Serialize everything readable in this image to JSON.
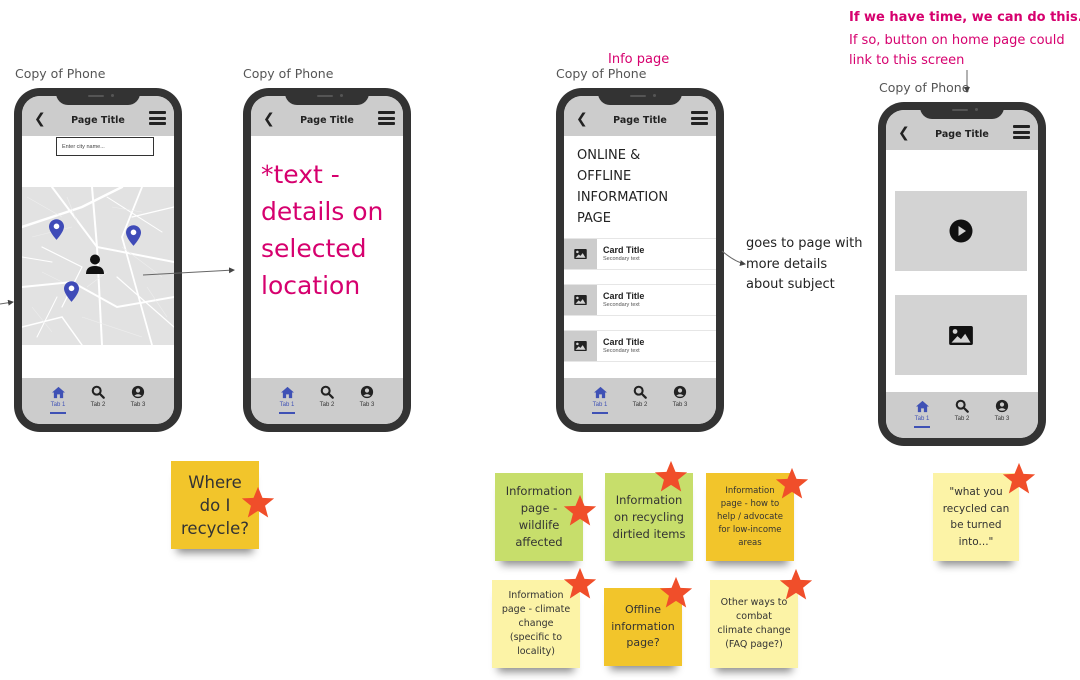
{
  "colors": {
    "accent_pink": "#d6006e",
    "phone_frame": "#333333",
    "header_gray": "#cccccc",
    "tab_active": "#3f51b5",
    "pin_blue": "#3f4bb8",
    "star_red": "#f04e2a",
    "sticky_yellow": "#f5d033",
    "sticky_green": "#c7de6b",
    "sticky_pale": "#fcf3a6"
  },
  "phones": [
    {
      "frame_label": "Copy of Phone",
      "header": {
        "back_icon": "chevron-left-icon",
        "title": "Page Title",
        "menu_icon": "hamburger-menu-icon"
      },
      "search": {
        "placeholder": "Enter city name..."
      },
      "map": {
        "pins": [
          "location-pin-icon",
          "location-pin-icon",
          "location-pin-icon"
        ],
        "user_icon": "user-icon"
      },
      "tabs": [
        {
          "label": "Tab 1",
          "icon": "home-icon",
          "active": true
        },
        {
          "label": "Tab 2",
          "icon": "search-icon",
          "active": false
        },
        {
          "label": "Tab 3",
          "icon": "account-circle-icon",
          "active": false
        }
      ]
    },
    {
      "frame_label": "Copy of Phone",
      "header": {
        "back_icon": "chevron-left-icon",
        "title": "Page Title",
        "menu_icon": "hamburger-menu-icon"
      },
      "body_text": [
        "*text -",
        "details on",
        "selected",
        "location"
      ],
      "tabs": [
        {
          "label": "Tab 1",
          "icon": "home-icon",
          "active": true
        },
        {
          "label": "Tab 2",
          "icon": "search-icon",
          "active": false
        },
        {
          "label": "Tab 3",
          "icon": "account-circle-icon",
          "active": false
        }
      ]
    },
    {
      "frame_label": "Copy of Phone",
      "annotation_above": "Info page",
      "header": {
        "back_icon": "chevron-left-icon",
        "title": "Page Title",
        "menu_icon": "hamburger-menu-icon"
      },
      "heading_lines": [
        "ONLINE &",
        "OFFLINE",
        "INFORMATION",
        "PAGE"
      ],
      "cards": [
        {
          "title": "Card Title",
          "secondary": "Secondary text",
          "icon": "image-icon"
        },
        {
          "title": "Card Title",
          "secondary": "Secondary text",
          "icon": "image-icon"
        },
        {
          "title": "Card Title",
          "secondary": "Secondary text",
          "icon": "image-icon"
        }
      ],
      "tabs": [
        {
          "label": "Tab 1",
          "icon": "home-icon",
          "active": true
        },
        {
          "label": "Tab 2",
          "icon": "search-icon",
          "active": false
        },
        {
          "label": "Tab 3",
          "icon": "account-circle-icon",
          "active": false
        }
      ]
    },
    {
      "frame_label": "Copy of Phone",
      "header": {
        "back_icon": "chevron-left-icon",
        "title": "Page Title",
        "menu_icon": "hamburger-menu-icon"
      },
      "media": [
        "play-circle-icon",
        "image-icon"
      ],
      "tabs": [
        {
          "label": "Tab 1",
          "icon": "home-icon",
          "active": true
        },
        {
          "label": "Tab 2",
          "icon": "search-icon",
          "active": false
        },
        {
          "label": "Tab 3",
          "icon": "account-circle-icon",
          "active": false
        }
      ]
    }
  ],
  "annotations": {
    "cards_note": [
      "goes to page with",
      "more details",
      "about subject"
    ],
    "stretch_bold": "If we have time, we can do this.",
    "stretch_lines": [
      "If so, button on home page could",
      "link to this screen"
    ]
  },
  "stickies": [
    {
      "lines": [
        "Where",
        "do I",
        "recycle?"
      ],
      "color": "yellow",
      "starred": true
    },
    {
      "lines": [
        "Information",
        "page -",
        "wildlife",
        "affected"
      ],
      "color": "green",
      "starred": true
    },
    {
      "lines": [
        "Information",
        "on recycling",
        "dirtied items"
      ],
      "color": "green",
      "starred": true
    },
    {
      "lines": [
        "Information",
        "page - how to",
        "help / advocate",
        "for low-income",
        "areas"
      ],
      "color": "yellow",
      "starred": true
    },
    {
      "lines": [
        "Information",
        "page - climate",
        "change",
        "(specific to",
        "locality)"
      ],
      "color": "pale",
      "starred": true
    },
    {
      "lines": [
        "Offline",
        "information",
        "page?"
      ],
      "color": "yellow",
      "starred": true
    },
    {
      "lines": [
        "Other ways to",
        "combat",
        "climate change",
        "(FAQ page?)"
      ],
      "color": "pale",
      "starred": true
    },
    {
      "lines": [
        "\"what you",
        "recycled can",
        "be turned",
        "into...\""
      ],
      "color": "pale",
      "starred": true
    }
  ]
}
